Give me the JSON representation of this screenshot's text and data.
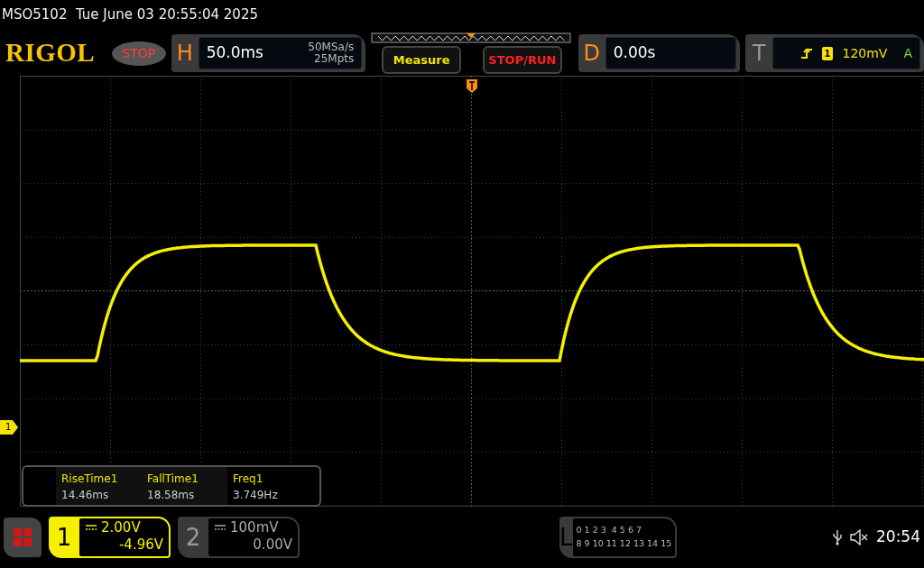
{
  "status_line": "MSO5102  Tue June 03 20:55:04 2025",
  "logo": "RIGOL",
  "run_state": "STOP",
  "horizontal": {
    "label": "H",
    "timebase": "50.0ms",
    "sample_rate": "50MSa/s",
    "memory_depth": "25Mpts"
  },
  "measure_button": "Measure",
  "stop_run_button": "STOP/RUN",
  "delay": {
    "label": "D",
    "value": "0.00s"
  },
  "trigger": {
    "label": "T",
    "source": "1",
    "level": "120mV",
    "mode": "A"
  },
  "channel_marker": "1",
  "measurements": [
    {
      "name": "RiseTime1",
      "value": "14.46ms"
    },
    {
      "name": "FallTime1",
      "value": "18.58ms"
    },
    {
      "name": "Freq1",
      "value": "3.749Hz"
    }
  ],
  "channels": [
    {
      "number": "1",
      "scale": "2.00V",
      "offset": "-4.96V",
      "selected": true
    },
    {
      "number": "2",
      "scale": "100mV",
      "offset": "0.00V",
      "selected": false
    }
  ],
  "logic": {
    "label": "L",
    "rows": [
      "0 1 2 3  4 5 6 7",
      "8 9 10 11 12 13 14 15"
    ]
  },
  "clock": "20:54"
}
